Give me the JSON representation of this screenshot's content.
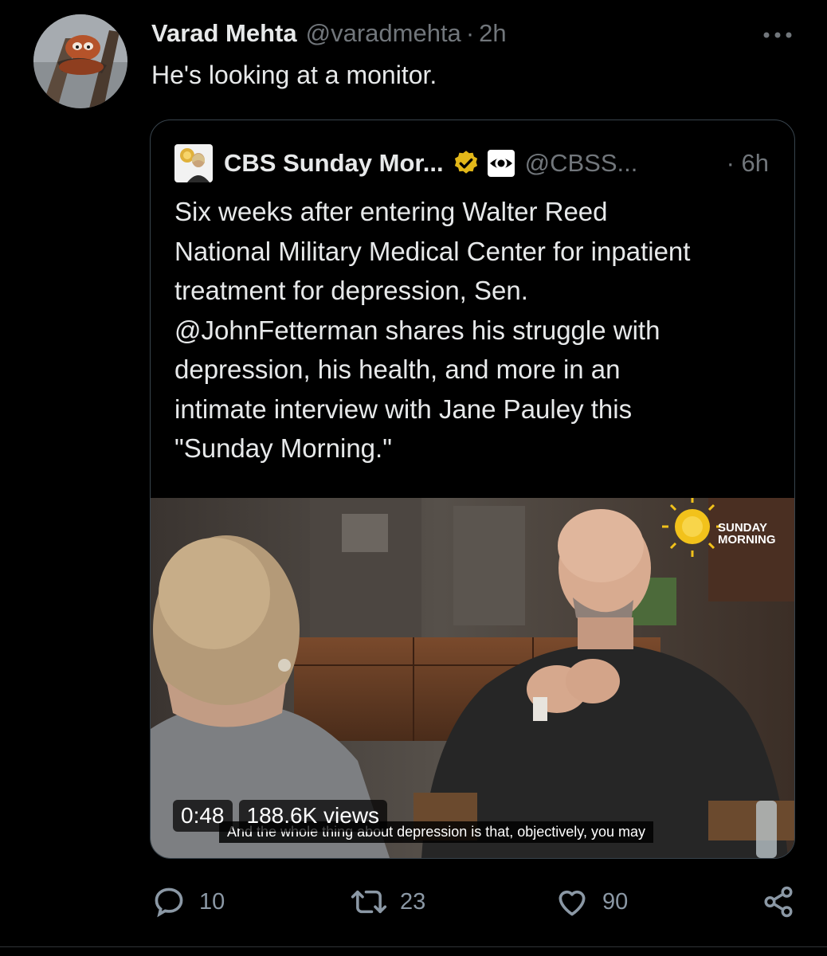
{
  "tweet": {
    "author_name": "Varad Mehta",
    "author_handle": "@varadmehta",
    "separator": "·",
    "time": "2h",
    "text": "He's looking at a monitor.",
    "more_icon": "more-horizontal-icon"
  },
  "quoted": {
    "author_name": "CBS Sunday Mor...",
    "author_handle": "@CBSS...",
    "time": "· 6h",
    "verified_color": "#e2b719",
    "text_lines": [
      "Six weeks after entering Walter Reed",
      "National Military Medical Center for inpatient",
      "treatment for depression, Sen.",
      "@JohnFetterman shares his struggle with",
      "depression, his health, and more in an",
      "intimate interview with Jane Pauley this",
      "\"Sunday Morning.\""
    ],
    "video": {
      "duration": "0:48",
      "views": "188.6K views",
      "caption": "And the whole thing about depression is that, objectively, you may",
      "logo_line1": "SUNDAY",
      "logo_line2": "MORNING"
    }
  },
  "actions": {
    "reply_count": "10",
    "retweet_count": "23",
    "like_count": "90",
    "accent": "#8b98a5"
  }
}
